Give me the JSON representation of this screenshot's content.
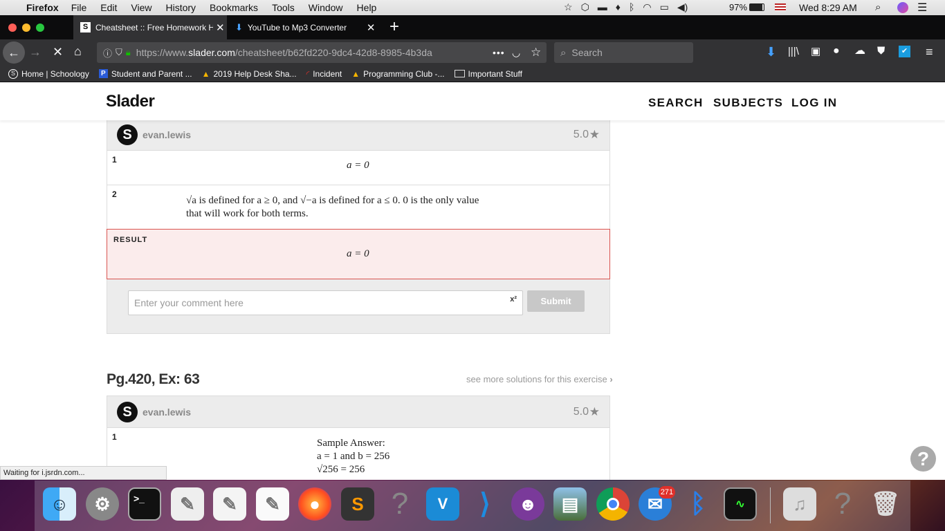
{
  "mac_menubar": {
    "app": "Firefox",
    "items": [
      "File",
      "Edit",
      "View",
      "History",
      "Bookmarks",
      "Tools",
      "Window",
      "Help"
    ],
    "battery": "97%",
    "clock": "Wed 8:29 AM"
  },
  "tabs": [
    {
      "title": "Cheatsheet :: Free Homework H",
      "favicon": "S"
    },
    {
      "title": "YouTube to Mp3 Converter"
    }
  ],
  "urlbar": {
    "url_prefix": "https://www.",
    "url_domain": "slader.com",
    "url_path": "/cheatsheet/b62fd220-9dc4-42d8-8985-4b3da",
    "more": "•••",
    "search_placeholder": "Search"
  },
  "bookmarks": [
    {
      "label": "Home | Schoology",
      "icon": "S"
    },
    {
      "label": "Student and Parent ...",
      "icon": "P"
    },
    {
      "label": "2019 Help Desk Sha..."
    },
    {
      "label": "Incident"
    },
    {
      "label": "Programming Club -..."
    },
    {
      "label": "Important Stuff"
    }
  ],
  "site": {
    "logo": "Slader",
    "nav": [
      "SEARCH",
      "SUBJECTS",
      "LOG IN"
    ]
  },
  "card1": {
    "avatar": "S",
    "user": "evan.lewis",
    "rating": "5.0",
    "steps": [
      {
        "n": "1",
        "text": "a = 0"
      },
      {
        "n": "2",
        "line1_a": "√a is defined for a ≥ 0, and √−a is defined for a ≤ 0. 0 is the only value",
        "line2": "that will work for both terms."
      }
    ],
    "result_label": "RESULT",
    "result": "a = 0",
    "comment_placeholder": "Enter your comment here",
    "sup": "x²",
    "submit": "Submit"
  },
  "exercise": {
    "title": "Pg.420, Ex: 63",
    "more": "see more solutions for this exercise"
  },
  "card2": {
    "avatar": "S",
    "user": "evan.lewis",
    "rating": "5.0",
    "step_n": "1",
    "lines": [
      "Sample Answer:",
      "a = 1 and b = 256",
      "√256 = 256"
    ]
  },
  "statusbar": "Waiting for i.jsrdn.com...",
  "help": "?",
  "dock_badge": "271"
}
